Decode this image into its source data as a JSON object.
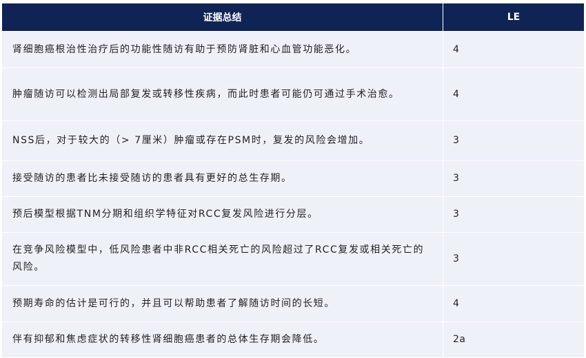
{
  "table": {
    "headers": {
      "summary": "证据总结",
      "le": "LE"
    },
    "rows": [
      {
        "summary": "肾细胞癌根治性治疗后的功能性随访有助于预防肾脏和心血管功能恶化。",
        "le": "4"
      },
      {
        "summary": "肿瘤随访可以检测出局部复发或转移性疾病，而此时患者可能仍可通过手术治愈。",
        "le": "4"
      },
      {
        "summary": "NSS后，对于较大的（> 7厘米）肿瘤或存在PSM时，复发的风险会增加。",
        "le": "3"
      },
      {
        "summary": "接受随访的患者比未接受随访的患者具有更好的总生存期。",
        "le": "3"
      },
      {
        "summary": "预后模型根据TNM分期和组织学特征对RCC复发风险进行分层。",
        "le": "3"
      },
      {
        "summary": "在竞争风险模型中，低风险患者中非RCC相关死亡的风险超过了RCC复发或相关死亡的风险。",
        "le": "3"
      },
      {
        "summary": "预期寿命的估计是可行的，并且可以帮助患者了解随访时间的长短。",
        "le": "4"
      },
      {
        "summary": "伴有抑郁和焦虑症状的转移性肾细胞癌患者的总体生存期会降低。",
        "le": "2a"
      }
    ]
  },
  "colors": {
    "header_background": "#0f2354",
    "header_text": "#ffffff",
    "row_background": "#eef1f8",
    "body_text": "#222222"
  }
}
